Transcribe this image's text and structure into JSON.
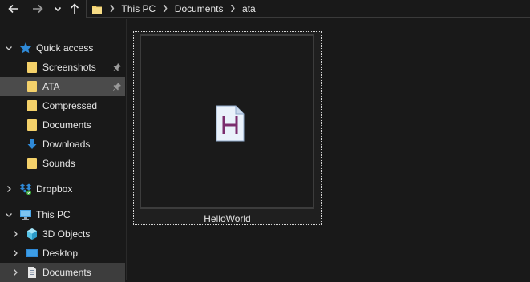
{
  "breadcrumb": {
    "items": [
      "This PC",
      "Documents",
      "ata"
    ]
  },
  "sidebar": {
    "items": [
      {
        "label": "Quick access",
        "icon": "star-icon",
        "pinned": false,
        "selected": false
      },
      {
        "label": "Screenshots",
        "icon": "folder-icon",
        "pinned": true,
        "selected": false
      },
      {
        "label": "ATA",
        "icon": "folder-icon",
        "pinned": true,
        "selected": true
      },
      {
        "label": "Compressed",
        "icon": "folder-icon",
        "pinned": false,
        "selected": false
      },
      {
        "label": "Documents",
        "icon": "folder-icon",
        "pinned": false,
        "selected": false
      },
      {
        "label": "Downloads",
        "icon": "download-icon",
        "pinned": false,
        "selected": false
      },
      {
        "label": "Sounds",
        "icon": "folder-icon",
        "pinned": false,
        "selected": false
      },
      {
        "label": "Dropbox",
        "icon": "dropbox-icon",
        "pinned": false,
        "selected": false
      },
      {
        "label": "This PC",
        "icon": "computer-icon",
        "pinned": false,
        "selected": false
      },
      {
        "label": "3D Objects",
        "icon": "cube-icon",
        "pinned": false,
        "selected": false
      },
      {
        "label": "Desktop",
        "icon": "desktop-icon",
        "pinned": false,
        "selected": false
      },
      {
        "label": "Documents",
        "icon": "document-icon",
        "pinned": false,
        "selected": true
      }
    ]
  },
  "content": {
    "files": [
      {
        "name": "HelloWorld",
        "icon_letter": "H"
      }
    ]
  },
  "colors": {
    "background": "#191919",
    "selected": "#4b4b4b",
    "folder_yellow": "#f4d16a",
    "file_letter": "#7b2d6e",
    "accent_blue": "#2f8ad8"
  }
}
